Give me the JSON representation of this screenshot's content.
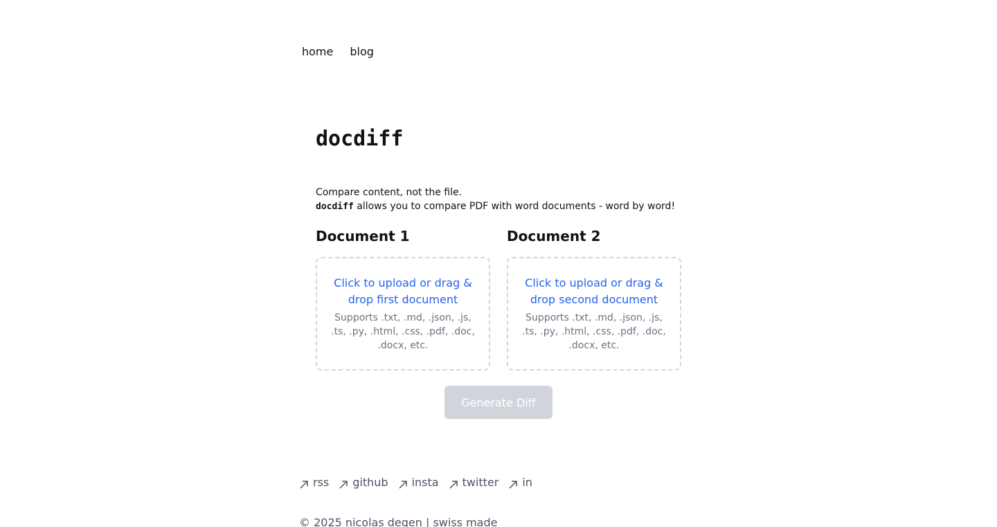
{
  "nav": {
    "items": [
      {
        "label": "home"
      },
      {
        "label": "blog"
      }
    ]
  },
  "main": {
    "title": "docdiff",
    "intro_line1": "Compare content, not the file.",
    "intro_brand": "docdiff",
    "intro_line2_rest": " allows you to compare PDF with word documents - word by word!",
    "documents": [
      {
        "heading": "Document 1",
        "cta": "Click to upload or drag & drop first document",
        "hint": "Supports .txt, .md, .json, .js, .ts, .py, .html, .css, .pdf, .doc, .docx, etc."
      },
      {
        "heading": "Document 2",
        "cta": "Click to upload or drag & drop second document",
        "hint": "Supports .txt, .md, .json, .js, .ts, .py, .html, .css, .pdf, .doc, .docx, etc."
      }
    ],
    "generate_label": "Generate Diff"
  },
  "footer": {
    "links": [
      {
        "label": "rss",
        "icon": "arrow-up-right-icon"
      },
      {
        "label": "github",
        "icon": "arrow-up-right-icon"
      },
      {
        "label": "insta",
        "icon": "arrow-up-right-icon"
      },
      {
        "label": "twitter",
        "icon": "arrow-up-right-icon"
      },
      {
        "label": "in",
        "icon": "arrow-up-right-icon"
      }
    ],
    "copyright": "© 2025 nicolas degen | swiss made"
  },
  "colors": {
    "link_blue": "#2563eb",
    "dropzone_border": "#d1d5db",
    "button_disabled": "#d1d5db",
    "muted_text": "#6b7280"
  }
}
